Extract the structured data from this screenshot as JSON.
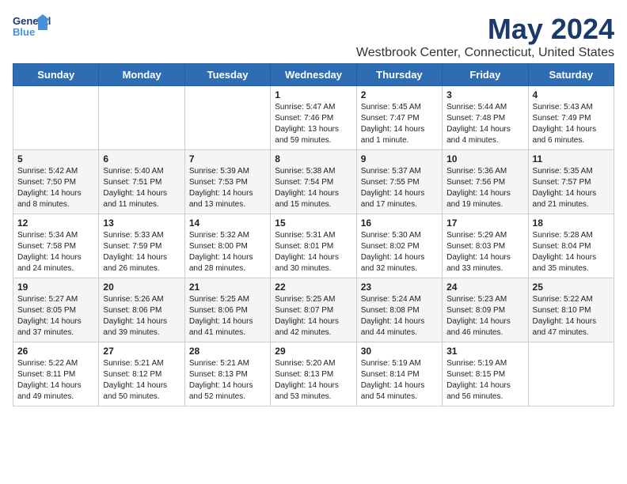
{
  "logo": {
    "line1": "General",
    "line2": "Blue"
  },
  "title": "May 2024",
  "subtitle": "Westbrook Center, Connecticut, United States",
  "days_of_week": [
    "Sunday",
    "Monday",
    "Tuesday",
    "Wednesday",
    "Thursday",
    "Friday",
    "Saturday"
  ],
  "weeks": [
    [
      {
        "day": "",
        "info": ""
      },
      {
        "day": "",
        "info": ""
      },
      {
        "day": "",
        "info": ""
      },
      {
        "day": "1",
        "info": "Sunrise: 5:47 AM\nSunset: 7:46 PM\nDaylight: 13 hours and 59 minutes."
      },
      {
        "day": "2",
        "info": "Sunrise: 5:45 AM\nSunset: 7:47 PM\nDaylight: 14 hours and 1 minute."
      },
      {
        "day": "3",
        "info": "Sunrise: 5:44 AM\nSunset: 7:48 PM\nDaylight: 14 hours and 4 minutes."
      },
      {
        "day": "4",
        "info": "Sunrise: 5:43 AM\nSunset: 7:49 PM\nDaylight: 14 hours and 6 minutes."
      }
    ],
    [
      {
        "day": "5",
        "info": "Sunrise: 5:42 AM\nSunset: 7:50 PM\nDaylight: 14 hours and 8 minutes."
      },
      {
        "day": "6",
        "info": "Sunrise: 5:40 AM\nSunset: 7:51 PM\nDaylight: 14 hours and 11 minutes."
      },
      {
        "day": "7",
        "info": "Sunrise: 5:39 AM\nSunset: 7:53 PM\nDaylight: 14 hours and 13 minutes."
      },
      {
        "day": "8",
        "info": "Sunrise: 5:38 AM\nSunset: 7:54 PM\nDaylight: 14 hours and 15 minutes."
      },
      {
        "day": "9",
        "info": "Sunrise: 5:37 AM\nSunset: 7:55 PM\nDaylight: 14 hours and 17 minutes."
      },
      {
        "day": "10",
        "info": "Sunrise: 5:36 AM\nSunset: 7:56 PM\nDaylight: 14 hours and 19 minutes."
      },
      {
        "day": "11",
        "info": "Sunrise: 5:35 AM\nSunset: 7:57 PM\nDaylight: 14 hours and 21 minutes."
      }
    ],
    [
      {
        "day": "12",
        "info": "Sunrise: 5:34 AM\nSunset: 7:58 PM\nDaylight: 14 hours and 24 minutes."
      },
      {
        "day": "13",
        "info": "Sunrise: 5:33 AM\nSunset: 7:59 PM\nDaylight: 14 hours and 26 minutes."
      },
      {
        "day": "14",
        "info": "Sunrise: 5:32 AM\nSunset: 8:00 PM\nDaylight: 14 hours and 28 minutes."
      },
      {
        "day": "15",
        "info": "Sunrise: 5:31 AM\nSunset: 8:01 PM\nDaylight: 14 hours and 30 minutes."
      },
      {
        "day": "16",
        "info": "Sunrise: 5:30 AM\nSunset: 8:02 PM\nDaylight: 14 hours and 32 minutes."
      },
      {
        "day": "17",
        "info": "Sunrise: 5:29 AM\nSunset: 8:03 PM\nDaylight: 14 hours and 33 minutes."
      },
      {
        "day": "18",
        "info": "Sunrise: 5:28 AM\nSunset: 8:04 PM\nDaylight: 14 hours and 35 minutes."
      }
    ],
    [
      {
        "day": "19",
        "info": "Sunrise: 5:27 AM\nSunset: 8:05 PM\nDaylight: 14 hours and 37 minutes."
      },
      {
        "day": "20",
        "info": "Sunrise: 5:26 AM\nSunset: 8:06 PM\nDaylight: 14 hours and 39 minutes."
      },
      {
        "day": "21",
        "info": "Sunrise: 5:25 AM\nSunset: 8:06 PM\nDaylight: 14 hours and 41 minutes."
      },
      {
        "day": "22",
        "info": "Sunrise: 5:25 AM\nSunset: 8:07 PM\nDaylight: 14 hours and 42 minutes."
      },
      {
        "day": "23",
        "info": "Sunrise: 5:24 AM\nSunset: 8:08 PM\nDaylight: 14 hours and 44 minutes."
      },
      {
        "day": "24",
        "info": "Sunrise: 5:23 AM\nSunset: 8:09 PM\nDaylight: 14 hours and 46 minutes."
      },
      {
        "day": "25",
        "info": "Sunrise: 5:22 AM\nSunset: 8:10 PM\nDaylight: 14 hours and 47 minutes."
      }
    ],
    [
      {
        "day": "26",
        "info": "Sunrise: 5:22 AM\nSunset: 8:11 PM\nDaylight: 14 hours and 49 minutes."
      },
      {
        "day": "27",
        "info": "Sunrise: 5:21 AM\nSunset: 8:12 PM\nDaylight: 14 hours and 50 minutes."
      },
      {
        "day": "28",
        "info": "Sunrise: 5:21 AM\nSunset: 8:13 PM\nDaylight: 14 hours and 52 minutes."
      },
      {
        "day": "29",
        "info": "Sunrise: 5:20 AM\nSunset: 8:13 PM\nDaylight: 14 hours and 53 minutes."
      },
      {
        "day": "30",
        "info": "Sunrise: 5:19 AM\nSunset: 8:14 PM\nDaylight: 14 hours and 54 minutes."
      },
      {
        "day": "31",
        "info": "Sunrise: 5:19 AM\nSunset: 8:15 PM\nDaylight: 14 hours and 56 minutes."
      },
      {
        "day": "",
        "info": ""
      }
    ]
  ]
}
